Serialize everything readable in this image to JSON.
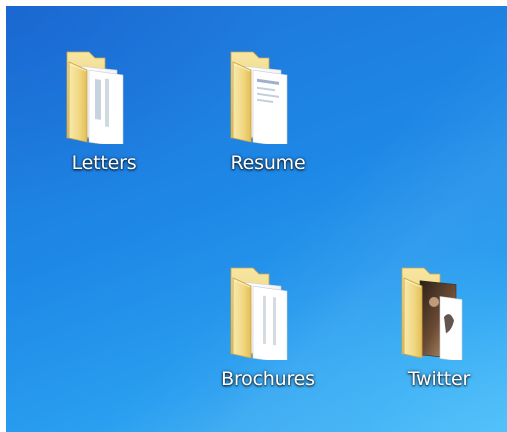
{
  "desktop": {
    "icons": [
      {
        "label": "Letters",
        "icon": "folder-documents-icon"
      },
      {
        "label": "Resume",
        "icon": "folder-documents-icon"
      },
      {
        "label": "Brochures",
        "icon": "folder-documents-icon"
      },
      {
        "label": "Twitter",
        "icon": "folder-photo-icon"
      }
    ]
  },
  "colors": {
    "wallpaper": "#1e88e6",
    "folder": "#f2d98a",
    "label_text": "#ffffff"
  }
}
